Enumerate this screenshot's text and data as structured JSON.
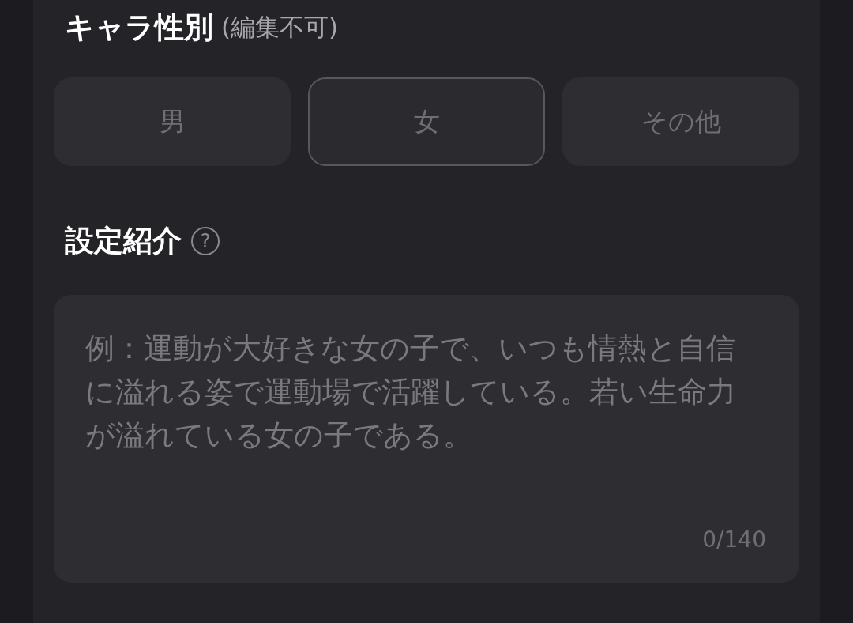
{
  "gender": {
    "label": "キャラ性別",
    "note": "(編集不可)",
    "options": [
      {
        "label": "男",
        "selected": false
      },
      {
        "label": "女",
        "selected": true
      },
      {
        "label": "その他",
        "selected": false
      }
    ]
  },
  "intro": {
    "label": "設定紹介",
    "help": "?",
    "placeholder": "例：運動が大好きな女の子で、いつも情熱と自信に溢れる姿で運動場で活躍している。若い生命力が溢れている女の子である。",
    "counter": "0/140"
  }
}
